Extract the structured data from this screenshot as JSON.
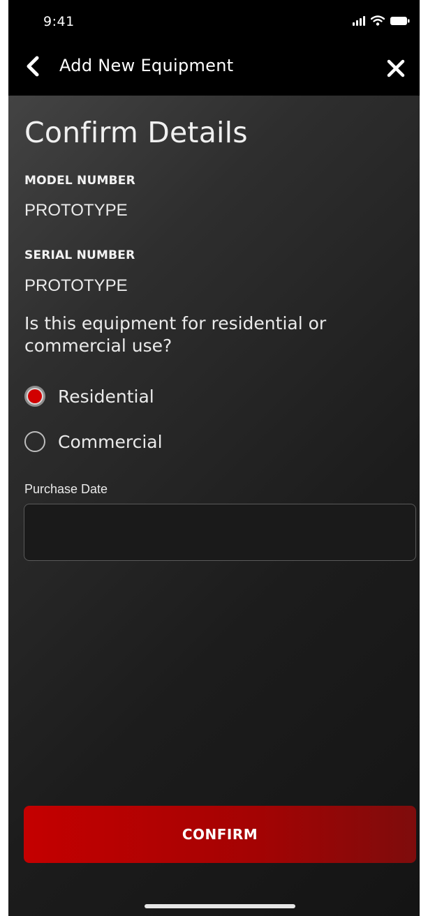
{
  "status_bar": {
    "time": "9:41"
  },
  "nav": {
    "title": "Add New Equipment",
    "back_icon": "chevron-left-icon",
    "close_icon": "close-icon"
  },
  "page": {
    "title": "Confirm Details"
  },
  "details": {
    "model_label": "MODEL NUMBER",
    "model_value": "PROTOTYPE",
    "serial_label": "SERIAL NUMBER",
    "serial_value": "PROTOTYPE"
  },
  "usage": {
    "question": "Is this equipment for residential or commercial use?",
    "options": [
      {
        "label": "Residential",
        "selected": true
      },
      {
        "label": "Commercial",
        "selected": false
      }
    ]
  },
  "purchase": {
    "label": "Purchase Date",
    "value": "",
    "placeholder": ""
  },
  "actions": {
    "confirm_label": "CONFIRM"
  },
  "colors": {
    "accent": "#c40000",
    "background": "#1c1c1c",
    "header": "#000000"
  }
}
